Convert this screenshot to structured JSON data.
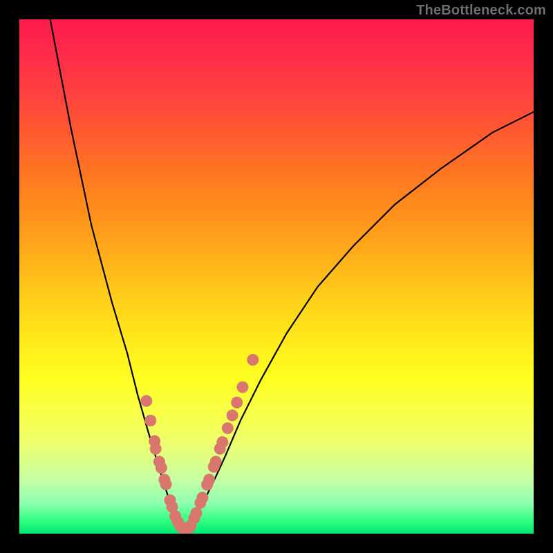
{
  "watermark": "TheBottleneck.com",
  "colors": {
    "frame": "#000000",
    "curve": "#000000",
    "dot": "#d9776f"
  },
  "chart_data": {
    "type": "line",
    "title": "",
    "xlabel": "",
    "ylabel": "",
    "xlim": [
      0,
      100
    ],
    "ylim": [
      0,
      100
    ],
    "grid": false,
    "legend": false,
    "background_gradient": {
      "direction": "vertical",
      "stops": [
        {
          "pos": 0.0,
          "color": "#ff1a4d"
        },
        {
          "pos": 0.4,
          "color": "#ff981a"
        },
        {
          "pos": 0.7,
          "color": "#ffff22"
        },
        {
          "pos": 0.95,
          "color": "#30ff80"
        },
        {
          "pos": 1.0,
          "color": "#00e870"
        }
      ]
    },
    "series": [
      {
        "name": "left-branch",
        "x": [
          6,
          10,
          14,
          18,
          21,
          23,
          25,
          26.8,
          28.2,
          29.3,
          30.0,
          30.5,
          31.0,
          31.5
        ],
        "y": [
          100,
          79,
          60,
          45,
          35,
          27,
          20,
          14,
          9.5,
          6,
          3.5,
          2,
          1,
          0.6
        ]
      },
      {
        "name": "right-branch",
        "x": [
          31.5,
          32.5,
          34,
          35.7,
          37.7,
          40,
          43,
          47,
          52,
          58,
          65,
          73,
          82,
          92,
          100
        ],
        "y": [
          0.6,
          1.3,
          3,
          6,
          10,
          15,
          22,
          30,
          39,
          48,
          56,
          64,
          71,
          78,
          82
        ]
      }
    ],
    "scatter_points": {
      "name": "marked-region",
      "comment": "salmon dots clustered along the lower V",
      "points": [
        {
          "x": 24.7,
          "y": 25.8
        },
        {
          "x": 25.5,
          "y": 22.0
        },
        {
          "x": 26.3,
          "y": 18.0
        },
        {
          "x": 26.5,
          "y": 16.5
        },
        {
          "x": 27.2,
          "y": 14.0
        },
        {
          "x": 27.6,
          "y": 12.8
        },
        {
          "x": 28.2,
          "y": 10.5
        },
        {
          "x": 28.5,
          "y": 9.6
        },
        {
          "x": 29.3,
          "y": 6.5
        },
        {
          "x": 29.7,
          "y": 5.2
        },
        {
          "x": 30.3,
          "y": 3.4
        },
        {
          "x": 30.8,
          "y": 2.3
        },
        {
          "x": 31.3,
          "y": 1.4
        },
        {
          "x": 31.8,
          "y": 1.0
        },
        {
          "x": 32.3,
          "y": 1.0
        },
        {
          "x": 32.8,
          "y": 1.0
        },
        {
          "x": 33.3,
          "y": 1.5
        },
        {
          "x": 34.0,
          "y": 3.0
        },
        {
          "x": 34.4,
          "y": 4.0
        },
        {
          "x": 35.2,
          "y": 6.0
        },
        {
          "x": 35.6,
          "y": 7.0
        },
        {
          "x": 36.5,
          "y": 9.5
        },
        {
          "x": 36.9,
          "y": 10.5
        },
        {
          "x": 37.8,
          "y": 13.0
        },
        {
          "x": 38.2,
          "y": 14.0
        },
        {
          "x": 39.0,
          "y": 16.5
        },
        {
          "x": 39.5,
          "y": 17.8
        },
        {
          "x": 40.5,
          "y": 20.5
        },
        {
          "x": 41.4,
          "y": 23.0
        },
        {
          "x": 42.3,
          "y": 25.5
        },
        {
          "x": 43.4,
          "y": 28.5
        },
        {
          "x": 45.4,
          "y": 33.8
        }
      ]
    }
  }
}
